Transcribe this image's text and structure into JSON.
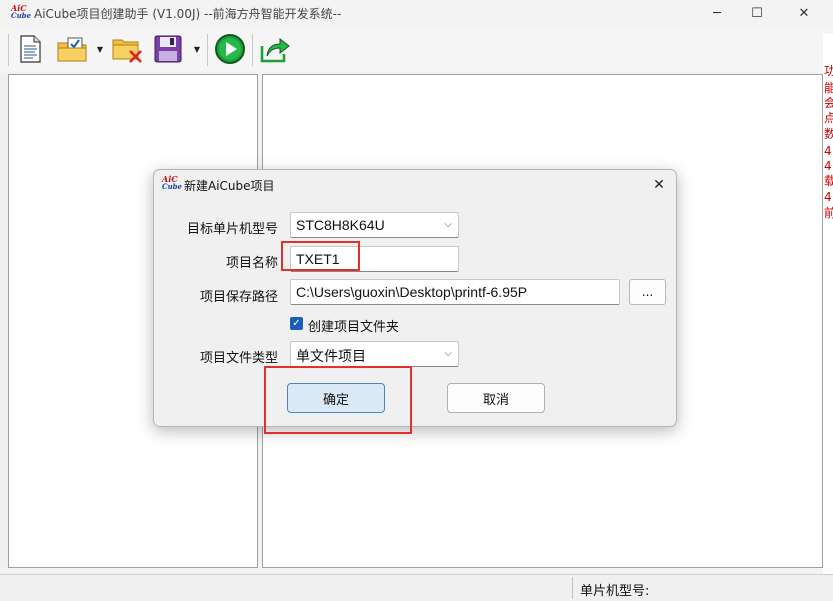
{
  "window": {
    "logo_top": "AiC",
    "logo_bottom": "Cube",
    "title": "AiCube项目创建助手 (V1.00J) --前海方舟智能开发系统--",
    "minimize_glyph": "─",
    "maximize_glyph": "☐",
    "close_glyph": "✕"
  },
  "toolbar": {
    "icons": [
      "new-document-icon",
      "open-folder-icon",
      "delete-folder-icon",
      "save-disk-icon",
      "run-play-icon",
      "export-share-icon"
    ],
    "dropdown_glyph": "▼"
  },
  "edge_text": [
    "功",
    "能",
    "会",
    "点",
    "数",
    "4",
    "4",
    "载",
    "4",
    "前"
  ],
  "statusbar": {
    "mcu_label": "单片机型号:"
  },
  "dialog": {
    "logo_top": "AiC",
    "logo_bottom": "Cube",
    "title": "新建AiCube项目",
    "close_glyph": "✕",
    "mcu_label": "目标单片机型号",
    "mcu_value": "STC8H8K64U",
    "name_label": "项目名称",
    "name_value": "TXET1",
    "path_label": "项目保存路径",
    "path_value": "C:\\Users\\guoxin\\Desktop\\printf-6.95P",
    "browse_label": "...",
    "create_folder_label": "创建项目文件夹",
    "create_folder_checked": true,
    "check_glyph": "✓",
    "type_label": "项目文件类型",
    "type_value": "单文件项目",
    "chevron_glyph": "⌵",
    "ok_label": "确定",
    "cancel_label": "取消"
  },
  "colors": {
    "highlight": "#e03030",
    "primary_button": "#dbe9f7",
    "checkbox": "#1a5fb4"
  }
}
